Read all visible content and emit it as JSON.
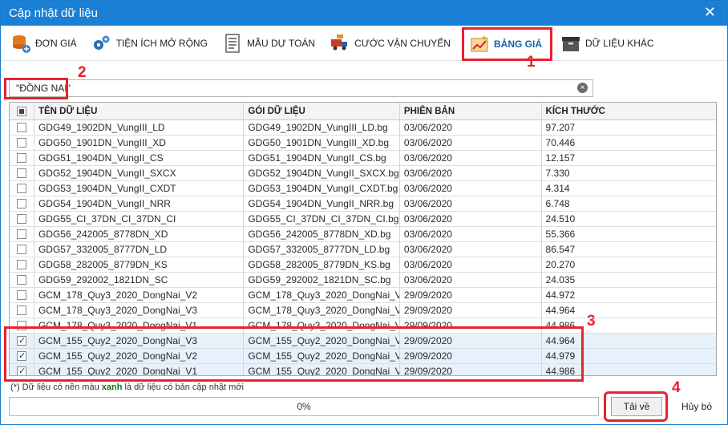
{
  "window": {
    "title": "Cập nhật dữ liệu",
    "close_glyph": "✕"
  },
  "toolbar": [
    {
      "label": "ĐƠN GIÁ",
      "icon": "database-add-icon",
      "name": "tab-don-gia"
    },
    {
      "label": "TIỆN ÍCH MỞ RỘNG",
      "icon": "gears-icon",
      "name": "tab-tien-ich"
    },
    {
      "label": "MẪU DỰ TOÁN",
      "icon": "document-icon",
      "name": "tab-mau-du-toan"
    },
    {
      "label": "CƯỚC VẬN CHUYỂN",
      "icon": "truck-icon",
      "name": "tab-cuoc-van-chuyen"
    },
    {
      "label": "BẢNG GIÁ",
      "icon": "chart-icon",
      "name": "tab-bang-gia",
      "active": true
    },
    {
      "label": "DỮ LIỆU KHÁC",
      "icon": "box-icon",
      "name": "tab-du-lieu-khac"
    }
  ],
  "markers": {
    "m1": "1",
    "m2": "2",
    "m3": "3",
    "m4": "4"
  },
  "search": {
    "value": "\"ĐỒNG NAI\"",
    "clear_glyph": "×"
  },
  "grid": {
    "headers": [
      "TÊN DỮ LIỆU",
      "GÓI DỮ LIỆU",
      "PHIÊN BẢN",
      "KÍCH THƯỚC"
    ],
    "rows": [
      {
        "checked": false,
        "selected": false,
        "name": "GDG49_1902DN_VungIII_LD",
        "file": "GDG49_1902DN_VungIII_LD.bg",
        "version": "03/06/2020",
        "size": "97.207"
      },
      {
        "checked": false,
        "selected": false,
        "name": "GDG50_1901DN_VungIII_XD",
        "file": "GDG50_1901DN_VungIII_XD.bg",
        "version": "03/06/2020",
        "size": "70.446"
      },
      {
        "checked": false,
        "selected": false,
        "name": "GDG51_1904DN_VungII_CS",
        "file": "GDG51_1904DN_VungII_CS.bg",
        "version": "03/06/2020",
        "size": "12.157"
      },
      {
        "checked": false,
        "selected": false,
        "name": "GDG52_1904DN_VungII_SXCX",
        "file": "GDG52_1904DN_VungII_SXCX.bg",
        "version": "03/06/2020",
        "size": "7.330"
      },
      {
        "checked": false,
        "selected": false,
        "name": "GDG53_1904DN_VungII_CXDT",
        "file": "GDG53_1904DN_VungII_CXDT.bg",
        "version": "03/06/2020",
        "size": "4.314"
      },
      {
        "checked": false,
        "selected": false,
        "name": "GDG54_1904DN_VungII_NRR",
        "file": "GDG54_1904DN_VungII_NRR.bg",
        "version": "03/06/2020",
        "size": "6.748"
      },
      {
        "checked": false,
        "selected": false,
        "name": "GDG55_CI_37DN_CI_37DN_CI",
        "file": "GDG55_CI_37DN_CI_37DN_CI.bg",
        "version": "03/06/2020",
        "size": "24.510"
      },
      {
        "checked": false,
        "selected": false,
        "name": "GDG56_242005_8778DN_XD",
        "file": "GDG56_242005_8778DN_XD.bg",
        "version": "03/06/2020",
        "size": "55.366"
      },
      {
        "checked": false,
        "selected": false,
        "name": "GDG57_332005_8777DN_LD",
        "file": "GDG57_332005_8777DN_LD.bg",
        "version": "03/06/2020",
        "size": "86.547"
      },
      {
        "checked": false,
        "selected": false,
        "name": "GDG58_282005_8779DN_KS",
        "file": "GDG58_282005_8779DN_KS.bg",
        "version": "03/06/2020",
        "size": "20.270"
      },
      {
        "checked": false,
        "selected": false,
        "name": "GDG59_292002_1821DN_SC",
        "file": "GDG59_292002_1821DN_SC.bg",
        "version": "03/06/2020",
        "size": "24.035"
      },
      {
        "checked": false,
        "selected": false,
        "name": "GCM_178_Quy3_2020_DongNai_V2",
        "file": "GCM_178_Quy3_2020_DongNai_V...",
        "version": "29/09/2020",
        "size": "44.972"
      },
      {
        "checked": false,
        "selected": false,
        "name": "GCM_178_Quy3_2020_DongNai_V3",
        "file": "GCM_178_Quy3_2020_DongNai_V...",
        "version": "29/09/2020",
        "size": "44.964"
      },
      {
        "checked": false,
        "selected": false,
        "name": "GCM_178_Quy3_2020_DongNai_V1",
        "file": "GCM_178_Quy3_2020_DongNai_V...",
        "version": "29/09/2020",
        "size": "44.986"
      },
      {
        "checked": true,
        "selected": true,
        "name": "GCM_155_Quy2_2020_DongNai_V3",
        "file": "GCM_155_Quy2_2020_DongNai_V...",
        "version": "29/09/2020",
        "size": "44.964"
      },
      {
        "checked": true,
        "selected": true,
        "name": "GCM_155_Quy2_2020_DongNai_V2",
        "file": "GCM_155_Quy2_2020_DongNai_V...",
        "version": "29/09/2020",
        "size": "44.979"
      },
      {
        "checked": true,
        "selected": true,
        "name": "GCM_155_Quy2_2020_DongNai_V1",
        "file": "GCM_155_Quy2_2020_DongNai_V...",
        "version": "29/09/2020",
        "size": "44.986"
      }
    ]
  },
  "footer": {
    "note_pre": "(*) Dữ liệu có nền màu ",
    "note_green": "xanh",
    "note_post": " là dữ liệu có bản cập nhật mới",
    "progress_value": 0,
    "progress_label": "0%",
    "download_label": "Tải về",
    "cancel_label": "Hủy bỏ"
  },
  "colors": {
    "title_bar": "#1a80d6",
    "highlight": "#e8222e",
    "selected_row": "#e6f1fb",
    "note_green": "#0a7a0a"
  }
}
